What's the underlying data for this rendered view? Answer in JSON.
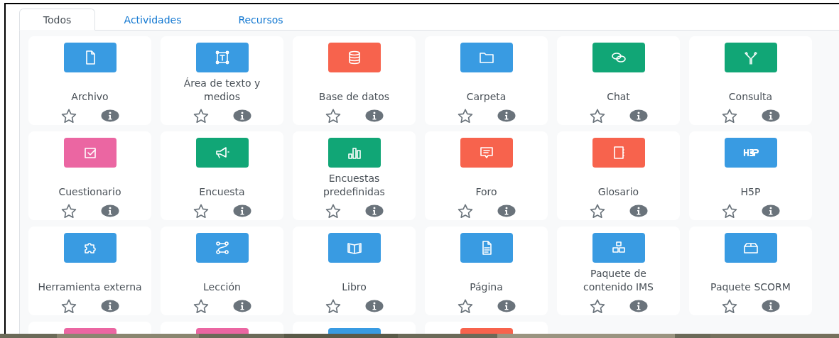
{
  "tabs": [
    {
      "label": "Todos",
      "selected": true
    },
    {
      "label": "Actividades",
      "selected": false
    },
    {
      "label": "Recursos",
      "selected": false
    }
  ],
  "modules": [
    {
      "label": "Archivo",
      "color": "#399be2",
      "starred": false
    },
    {
      "label": "Área de texto y medios",
      "color": "#399be2",
      "starred": false
    },
    {
      "label": "Base de datos",
      "color": "#f7634d",
      "starred": false
    },
    {
      "label": "Carpeta",
      "color": "#399be2",
      "starred": false
    },
    {
      "label": "Chat",
      "color": "#11a676",
      "starred": false
    },
    {
      "label": "Consulta",
      "color": "#11a676",
      "starred": false
    },
    {
      "label": "Cuestionario",
      "color": "#eb66a2",
      "starred": false
    },
    {
      "label": "Encuesta",
      "color": "#11a676",
      "starred": false
    },
    {
      "label": "Encuestas predefinidas",
      "color": "#11a676",
      "starred": false
    },
    {
      "label": "Foro",
      "color": "#f7634d",
      "starred": false
    },
    {
      "label": "Glosario",
      "color": "#f7634d",
      "starred": false
    },
    {
      "label": "H5P",
      "color": "#399be2",
      "starred": false
    },
    {
      "label": "Herramienta externa",
      "color": "#399be2",
      "starred": false
    },
    {
      "label": "Lección",
      "color": "#399be2",
      "starred": false
    },
    {
      "label": "Libro",
      "color": "#399be2",
      "starred": false
    },
    {
      "label": "Página",
      "color": "#399be2",
      "starred": false
    },
    {
      "label": "Paquete de contenido IMS",
      "color": "#399be2",
      "starred": false
    },
    {
      "label": "Paquete SCORM",
      "color": "#399be2",
      "starred": false
    },
    {
      "color": "#eb66a2"
    },
    {
      "color": "#eb66a2"
    },
    {
      "color": "#399be2"
    },
    {
      "color": "#f7634d"
    }
  ]
}
